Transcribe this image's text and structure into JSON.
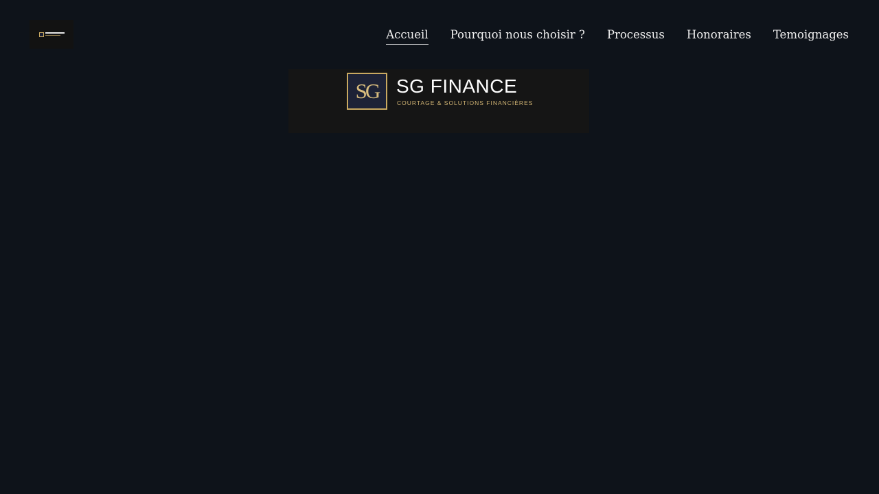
{
  "header": {
    "logo_alt": "SG FINANCE",
    "nav": [
      {
        "label": "Accueil",
        "active": true
      },
      {
        "label": "Pourquoi nous choisir ?",
        "active": false
      },
      {
        "label": "Processus",
        "active": false
      },
      {
        "label": "Honoraires",
        "active": false
      },
      {
        "label": "Temoignages",
        "active": false
      }
    ]
  },
  "hero": {
    "emblem": "SG",
    "brand_name": "SG FINANCE",
    "tagline": "COURTAGE & SOLUTIONS FINANCIÈRES"
  },
  "colors": {
    "background": "#0e131a",
    "gold": "#c9a961",
    "emblem_fill": "#1d2236"
  }
}
